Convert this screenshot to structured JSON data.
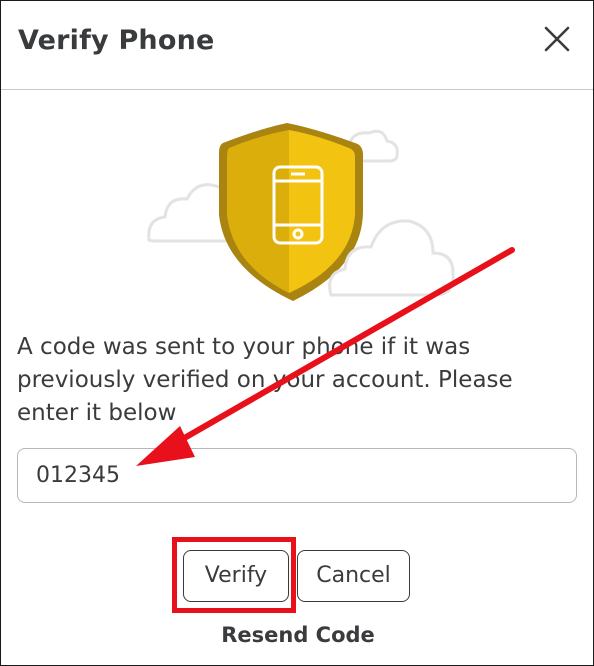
{
  "dialog": {
    "title": "Verify Phone",
    "close_icon": "close-icon",
    "illustration_icon": "phone-shield-icon",
    "message": "A code was sent to your phone if it was previously verified on your account. Please enter it below",
    "code_input": {
      "value": "012345"
    },
    "verify_label": "Verify",
    "cancel_label": "Cancel",
    "resend_label": "Resend Code"
  },
  "colors": {
    "shield_gold": "#f2c311",
    "shield_dark": "#dcae0c",
    "annotation_red": "#e8101a",
    "text": "#393b3d"
  }
}
